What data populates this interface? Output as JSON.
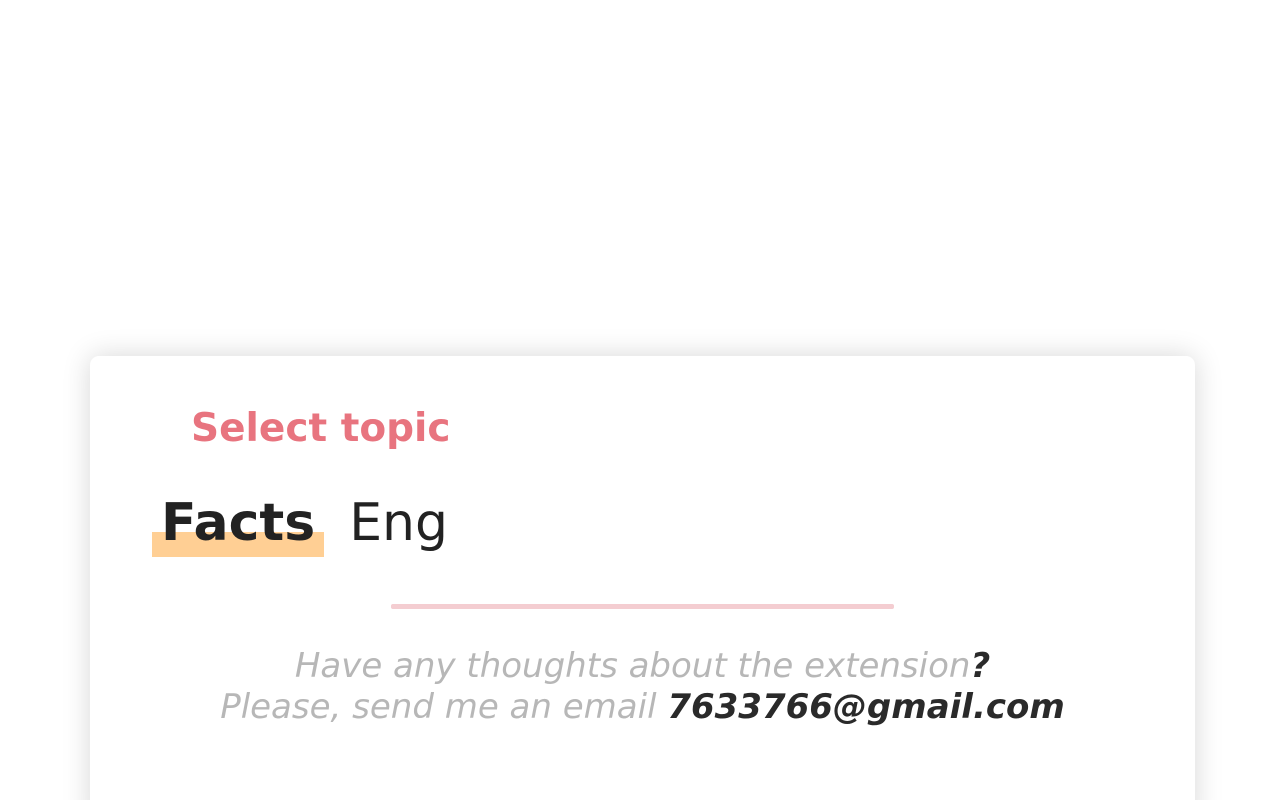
{
  "topic_selector": {
    "title": "Select topic",
    "tabs": [
      {
        "label": "Facts",
        "active": true
      },
      {
        "label": "Eng",
        "active": false
      }
    ]
  },
  "feedback": {
    "line1_text": "Have any thoughts about the extension",
    "line1_mark": "?",
    "line2_text": "Please, send me an email ",
    "email": "7633766@gmail.com"
  },
  "colors": {
    "title": "#e8747f",
    "tab_highlight": "#ffcf94",
    "divider": "#f4cdd1",
    "muted_text": "#b7b7b7",
    "dark_text": "#2a2a2a"
  }
}
